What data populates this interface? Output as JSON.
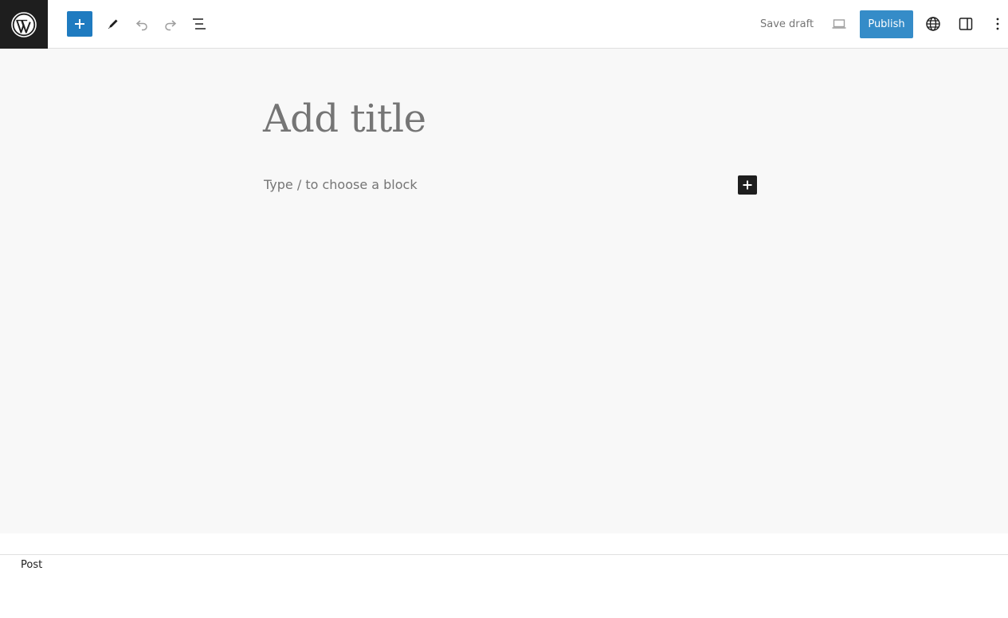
{
  "toolbar": {
    "logo_icon": "wordpress-logo-icon",
    "inserter_icon": "plus-icon",
    "tools_icon": "pencil-icon",
    "undo_icon": "undo-icon",
    "redo_icon": "redo-icon",
    "list_view_icon": "list-view-icon",
    "save_draft_label": "Save draft",
    "preview_icon": "laptop-icon",
    "publish_label": "Publish",
    "view_site_icon": "globe-icon",
    "settings_icon": "sidebar-toggle-icon",
    "options_icon": "more-vertical-icon",
    "accent_color": "#2b86c6"
  },
  "editor": {
    "title_placeholder": "Add title",
    "block_placeholder": "Type / to choose a block",
    "block_inserter_icon": "plus-icon"
  },
  "footer": {
    "breadcrumb": "Post"
  }
}
